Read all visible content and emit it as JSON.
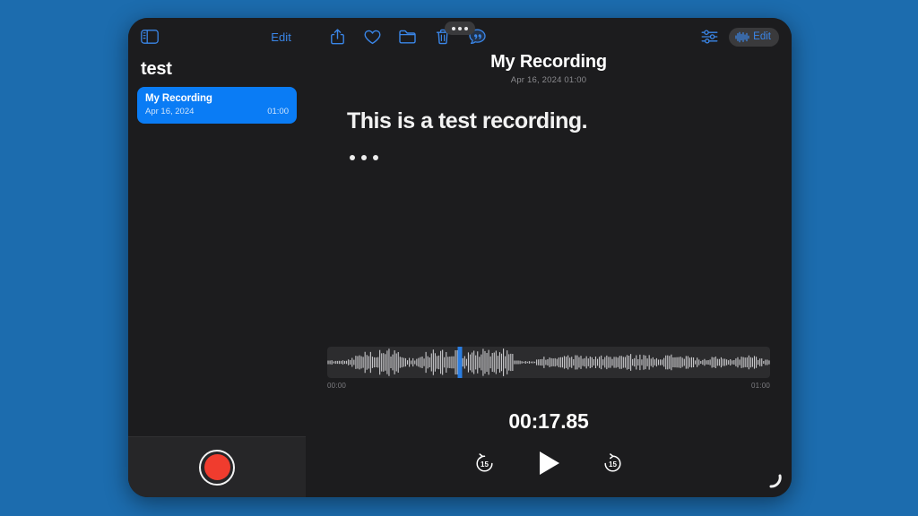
{
  "window": {
    "multitask_handle": "multitask-handle"
  },
  "sidebar": {
    "toggle_icon": "sidebar-toggle-icon",
    "edit_label": "Edit",
    "title": "test",
    "recordings": [
      {
        "name": "My Recording",
        "date": "Apr 16, 2024",
        "duration": "01:00",
        "selected": true
      }
    ],
    "record_button": "record-button"
  },
  "toolbar": {
    "share_icon": "share-icon",
    "favorite_icon": "heart-icon",
    "folder_icon": "folder-icon",
    "delete_icon": "trash-icon",
    "transcript_icon": "transcript-bubble-icon",
    "settings_icon": "audio-settings-icon",
    "edit_pill_label": "Edit",
    "edit_pill_icon": "waveform-icon"
  },
  "detail": {
    "title": "My Recording",
    "subtitle": "Apr 16, 2024  01:00",
    "transcript": {
      "text": "This is a test recording.",
      "ellipsis": "..."
    }
  },
  "player": {
    "start_time": "00:00",
    "end_time": "01:00",
    "current_time": "00:17.85",
    "playhead_percent": 30,
    "skip_back_label": "15",
    "skip_forward_label": "15",
    "play_icon": "play-icon",
    "skip_back_icon": "skip-back-15-icon",
    "skip_forward_icon": "skip-forward-15-icon"
  },
  "colors": {
    "desktop_background": "#1c6cae",
    "app_background": "#1c1c1e",
    "accent_blue": "#3a86e8",
    "selection_blue": "#0a7cf5",
    "record_red": "#f03c2e",
    "playhead_blue": "#2a7de1"
  }
}
